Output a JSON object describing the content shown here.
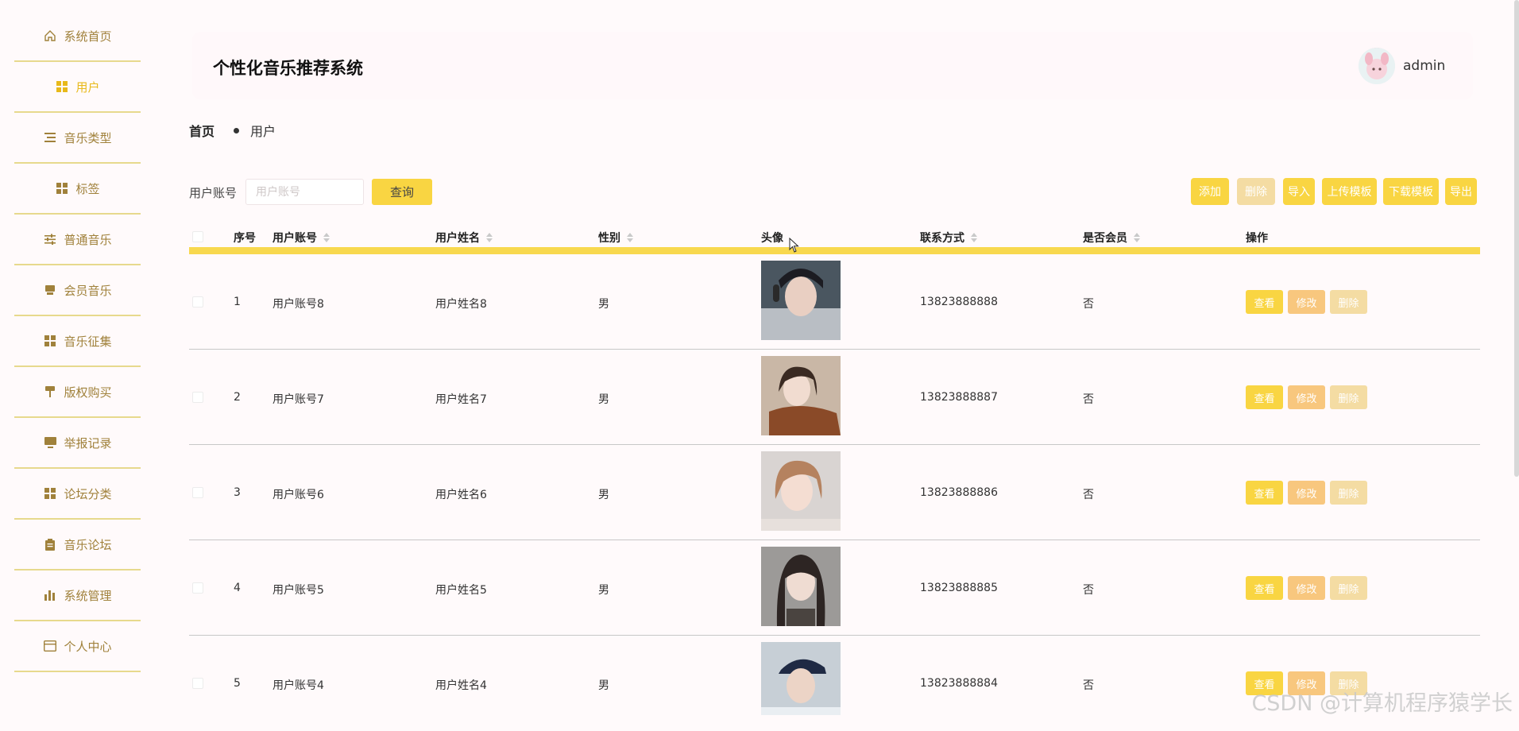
{
  "app": {
    "title": "个性化音乐推荐系统",
    "username": "admin"
  },
  "sidebar": {
    "items": [
      {
        "label": "系统首页",
        "icon": "home-icon"
      },
      {
        "label": "用户",
        "icon": "grid-icon"
      },
      {
        "label": "音乐类型",
        "icon": "list-icon"
      },
      {
        "label": "标签",
        "icon": "grid-icon"
      },
      {
        "label": "普通音乐",
        "icon": "sliders-icon"
      },
      {
        "label": "会员音乐",
        "icon": "printer-icon"
      },
      {
        "label": "音乐征集",
        "icon": "grid-icon"
      },
      {
        "label": "版权购买",
        "icon": "paint-roller-icon"
      },
      {
        "label": "举报记录",
        "icon": "monitor-icon"
      },
      {
        "label": "论坛分类",
        "icon": "grid-icon"
      },
      {
        "label": "音乐论坛",
        "icon": "clipboard-icon"
      },
      {
        "label": "系统管理",
        "icon": "bar-chart-icon"
      },
      {
        "label": "个人中心",
        "icon": "id-card-icon"
      }
    ],
    "active_color": "#e8b91a",
    "text_color": "#a0813b"
  },
  "breadcrumb": {
    "home": "首页",
    "current": "用户"
  },
  "search": {
    "label": "用户账号",
    "placeholder": "用户账号",
    "button": "查询"
  },
  "toolbar": {
    "add": "添加",
    "delete": "删除",
    "import": "导入",
    "upload_template": "上传模板",
    "download_template": "下载模板",
    "export": "导出"
  },
  "table": {
    "headers": {
      "index": "序号",
      "account": "用户账号",
      "name": "用户姓名",
      "gender": "性别",
      "avatar": "头像",
      "phone": "联系方式",
      "member": "是否会员",
      "actions": "操作"
    },
    "row_actions": {
      "view": "查看",
      "edit": "修改",
      "delete": "删除"
    },
    "rows": [
      {
        "index": "1",
        "account": "用户账号8",
        "name": "用户姓名8",
        "gender": "男",
        "phone": "13823888888",
        "member": "否"
      },
      {
        "index": "2",
        "account": "用户账号7",
        "name": "用户姓名7",
        "gender": "男",
        "phone": "13823888887",
        "member": "否"
      },
      {
        "index": "3",
        "account": "用户账号6",
        "name": "用户姓名6",
        "gender": "男",
        "phone": "13823888886",
        "member": "否"
      },
      {
        "index": "4",
        "account": "用户账号5",
        "name": "用户姓名5",
        "gender": "男",
        "phone": "13823888885",
        "member": "否"
      },
      {
        "index": "5",
        "account": "用户账号4",
        "name": "用户姓名4",
        "gender": "男",
        "phone": "13823888884",
        "member": "否"
      }
    ]
  },
  "colors": {
    "accent": "#f9d542",
    "header_rule": "#f8d84e",
    "background": "#fffafb"
  },
  "watermark": "CSDN @计算机程序猿学长"
}
